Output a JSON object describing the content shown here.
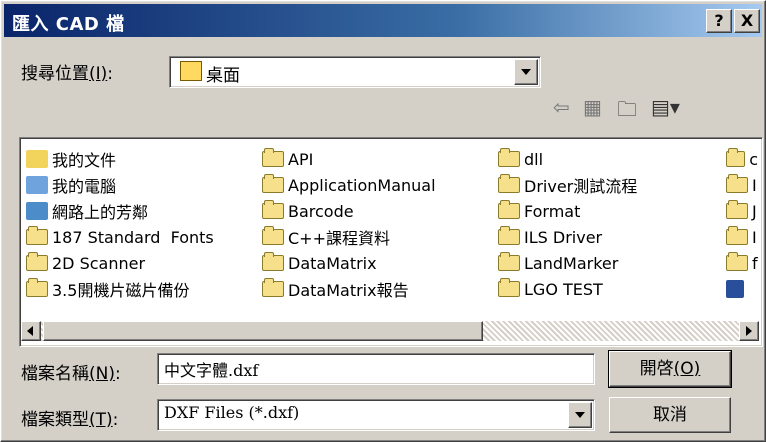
{
  "window": {
    "title": "匯入 CAD 檔",
    "help_label": "?",
    "close_label": "X"
  },
  "lookin": {
    "label_prefix": "搜尋位置",
    "label_hotkey": "(I)",
    "label_suffix": ":",
    "value": "桌面"
  },
  "files": {
    "col1": [
      {
        "name": "我的文件",
        "icon": "my-documents-icon"
      },
      {
        "name": "我的電腦",
        "icon": "my-computer-icon"
      },
      {
        "name": "網路上的芳鄰",
        "icon": "network-places-icon"
      },
      {
        "name": "187 Standard  Fonts",
        "icon": "folder-icon"
      },
      {
        "name": "2D Scanner",
        "icon": "folder-icon"
      },
      {
        "name": "3.5開機片磁片備份",
        "icon": "folder-icon"
      }
    ],
    "col2": [
      {
        "name": "API",
        "icon": "folder-icon"
      },
      {
        "name": "ApplicationManual",
        "icon": "folder-icon"
      },
      {
        "name": "Barcode",
        "icon": "folder-icon"
      },
      {
        "name": "C++課程資料",
        "icon": "folder-icon"
      },
      {
        "name": "DataMatrix",
        "icon": "folder-icon"
      },
      {
        "name": "DataMatrix報告",
        "icon": "folder-icon"
      }
    ],
    "col3": [
      {
        "name": "dll",
        "icon": "folder-icon"
      },
      {
        "name": "Driver測試流程",
        "icon": "folder-icon"
      },
      {
        "name": "Format",
        "icon": "folder-icon"
      },
      {
        "name": "ILS Driver",
        "icon": "folder-icon"
      },
      {
        "name": "LandMarker",
        "icon": "folder-icon"
      },
      {
        "name": "LGO TEST",
        "icon": "folder-icon"
      }
    ],
    "col4_partial": [
      {
        "name": "c",
        "icon": "folder-icon"
      },
      {
        "name": "I",
        "icon": "folder-icon"
      },
      {
        "name": "J",
        "icon": "folder-icon"
      },
      {
        "name": "I",
        "icon": "folder-icon"
      },
      {
        "name": "f",
        "icon": "folder-icon"
      },
      {
        "name": "",
        "icon": "dxf-file-icon"
      }
    ]
  },
  "filename": {
    "label_prefix": "檔案名稱",
    "label_hotkey": "(N)",
    "label_suffix": ":",
    "value": "中文字體.dxf"
  },
  "filetype": {
    "label_prefix": "檔案類型",
    "label_hotkey": "(T)",
    "label_suffix": ":",
    "value": "DXF Files (*.dxf)"
  },
  "buttons": {
    "open_prefix": "開啓",
    "open_hotkey": "(O)",
    "cancel": "取消"
  },
  "colors": {
    "title_start": "#0a246a",
    "title_end": "#a6caf0",
    "face": "#d4d0c8"
  }
}
